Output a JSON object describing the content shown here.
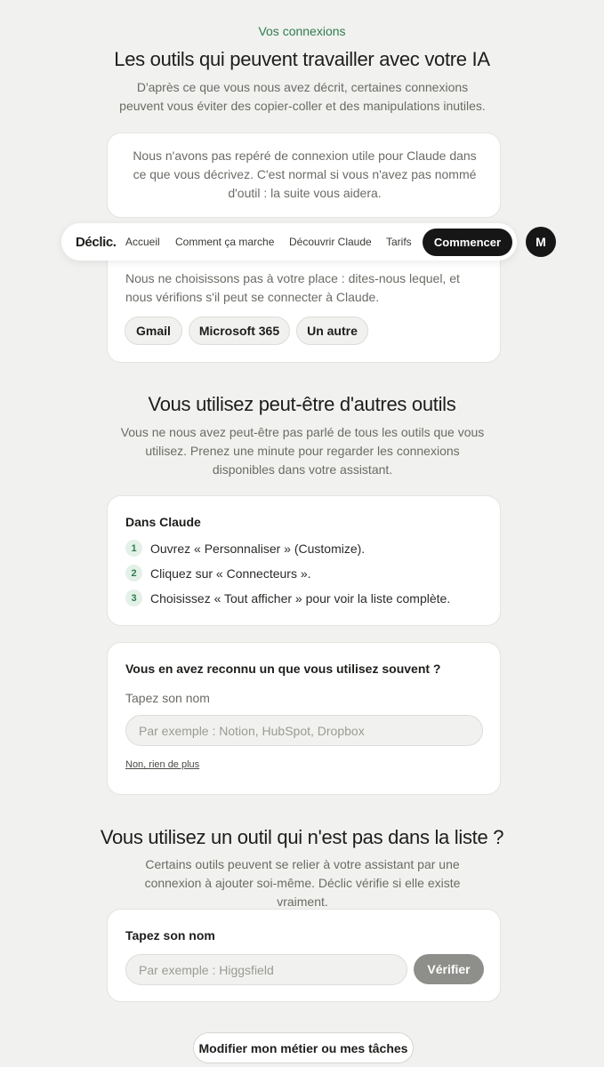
{
  "header": {
    "eyebrow": "Vos connexions",
    "title": "Les outils qui peuvent travailler avec votre IA",
    "lead": "D'après ce que vous nous avez décrit, certaines connexions peuvent vous éviter des copier-coller et des manipulations inutiles."
  },
  "notice_card": {
    "text": "Nous n'avons pas repéré de connexion utile pour Claude dans ce que vous décrivez. C'est normal si vous n'avez pas nommé d'outil : la suite vous aidera."
  },
  "navbar": {
    "logo": "Déclic.",
    "links": [
      "Accueil",
      "Comment ça marche",
      "Découvrir Claude",
      "Tarifs"
    ],
    "cta": "Commencer",
    "avatar": "M"
  },
  "choice_card": {
    "text": "Nous ne choisissons pas à votre place : dites-nous lequel, et nous vérifions s'il peut se connecter à Claude.",
    "options": [
      "Gmail",
      "Microsoft 365",
      "Un autre"
    ]
  },
  "other_tools": {
    "title": "Vous utilisez peut-être d'autres outils",
    "lead": "Vous ne nous avez peut-être pas parlé de tous les outils que vous utilisez. Prenez une minute pour regarder les connexions disponibles dans votre assistant."
  },
  "steps_card": {
    "heading": "Dans Claude",
    "steps": [
      {
        "num": "1",
        "text": "Ouvrez « Personnaliser » (Customize)."
      },
      {
        "num": "2",
        "text": "Cliquez sur « Connecteurs »."
      },
      {
        "num": "3",
        "text": "Choisissez « Tout afficher » pour voir la liste complète."
      }
    ]
  },
  "recognize_card": {
    "heading": "Vous en avez reconnu un que vous utilisez souvent ?",
    "label": "Tapez son nom",
    "placeholder": "Par exemple : Notion, HubSpot, Dropbox",
    "none_link": "Non, rien de plus"
  },
  "not_listed": {
    "title": "Vous utilisez un outil qui n'est pas dans la liste ?",
    "lead": "Certains outils peuvent se relier à votre assistant par une connexion à ajouter soi-même. Déclic vérifie si elle existe vraiment."
  },
  "verify_card": {
    "heading": "Tapez son nom",
    "placeholder": "Par exemple : Higgsfield",
    "button": "Vérifier"
  },
  "footer": {
    "modify_button": "Modifier mon métier ou mes tâches"
  },
  "colors": {
    "accent_green": "#2f7d4f",
    "background": "#f1f1ef",
    "dark": "#161616"
  }
}
